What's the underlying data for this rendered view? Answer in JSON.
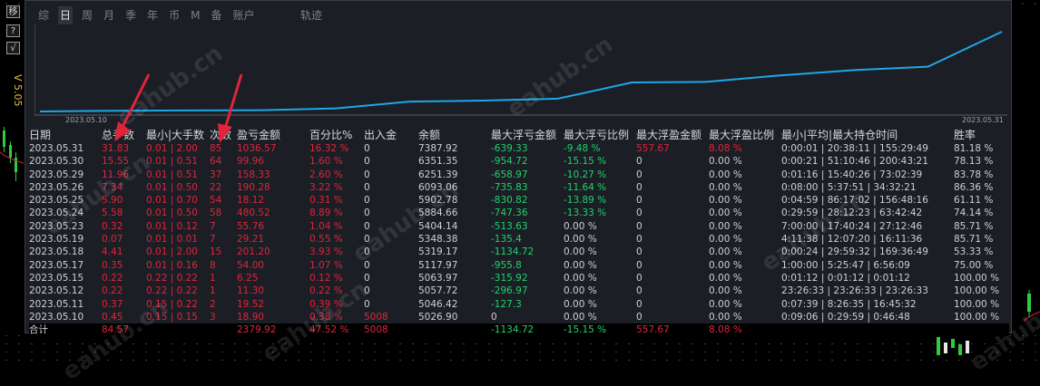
{
  "toolbar": {
    "btn_a": "移",
    "btn_b": "?",
    "btn_c": "√",
    "side_label": "V 5.05"
  },
  "tabs": [
    {
      "label": "综",
      "active": false
    },
    {
      "label": "日",
      "active": true
    },
    {
      "label": "周",
      "active": false
    },
    {
      "label": "月",
      "active": false
    },
    {
      "label": "季",
      "active": false
    },
    {
      "label": "年",
      "active": false
    },
    {
      "label": "币",
      "active": false
    },
    {
      "label": "M",
      "active": false
    },
    {
      "label": "备",
      "active": false
    },
    {
      "label": "账户",
      "active": false
    }
  ],
  "track_label": "轨迹",
  "equity_chart": {
    "start_date": "2023.05.10",
    "end_date": "2023.05.31",
    "line_color": "#1ea7e6",
    "values": [
      5026.9,
      5046.42,
      5057.72,
      5063.97,
      5117.97,
      5319.17,
      5348.38,
      5404.14,
      5884.66,
      5902.78,
      6093.06,
      6251.39,
      6351.35,
      7387.92
    ]
  },
  "table": {
    "headers": [
      "日期",
      "总手数",
      "最小|大手数",
      "次数",
      "盈亏金额",
      "百分比%",
      "出入金",
      "余额",
      "最大浮亏金额",
      "最大浮亏比例",
      "最大浮盈金额",
      "最大浮盈比例",
      "最小|平均|最大持仓时间",
      "胜率"
    ],
    "rows": [
      [
        "2023.05.31",
        "31.83",
        "0.01 | 2.00",
        "85",
        "1036.57",
        "16.32 %",
        "0",
        "7387.92",
        "-639.33",
        "-9.48 %",
        "557.67",
        "8.08 %",
        "0:00:01 | 20:38:11 | 155:29:49",
        "81.18 %"
      ],
      [
        "2023.05.30",
        "15.55",
        "0.01 | 0.51",
        "64",
        "99.96",
        "1.60 %",
        "0",
        "6351.35",
        "-954.72",
        "-15.15 %",
        "0",
        "0.00 %",
        "0:00:21 | 51:10:46 | 200:43:21",
        "78.13 %"
      ],
      [
        "2023.05.29",
        "11.96",
        "0.01 | 0.51",
        "37",
        "158.33",
        "2.60 %",
        "0",
        "6251.39",
        "-658.97",
        "-10.27 %",
        "0",
        "0.00 %",
        "0:01:16 | 15:40:26 | 73:02:39",
        "83.78 %"
      ],
      [
        "2023.05.26",
        "7.34",
        "0.01 | 0.50",
        "22",
        "190.28",
        "3.22 %",
        "0",
        "6093.06",
        "-735.83",
        "-11.64 %",
        "0",
        "0.00 %",
        "0:08:00 | 5:37:51 | 34:32:21",
        "86.36 %"
      ],
      [
        "2023.05.25",
        "5.90",
        "0.01 | 0.70",
        "54",
        "18.12",
        "0.31 %",
        "0",
        "5902.78",
        "-830.82",
        "-13.89 %",
        "0",
        "0.00 %",
        "0:04:59 | 86:17:02 | 156:48:16",
        "61.11 %"
      ],
      [
        "2023.05.24",
        "5.58",
        "0.01 | 0.50",
        "58",
        "480.52",
        "8.89 %",
        "0",
        "5884.66",
        "-747.36",
        "-13.33 %",
        "0",
        "0.00 %",
        "0:29:59 | 28:12:23 | 63:42:42",
        "74.14 %"
      ],
      [
        "2023.05.23",
        "0.32",
        "0.01 | 0.12",
        "7",
        "55.76",
        "1.04 %",
        "0",
        "5404.14",
        "-513.63",
        "0.00 %",
        "0",
        "0.00 %",
        "7:00:00 | 17:40:24 | 27:12:46",
        "85.71 %"
      ],
      [
        "2023.05.19",
        "0.07",
        "0.01 | 0.01",
        "7",
        "29.21",
        "0.55 %",
        "0",
        "5348.38",
        "-135.4",
        "0.00 %",
        "0",
        "0.00 %",
        "4:11:38 | 12:07:20 | 16:11:36",
        "85.71 %"
      ],
      [
        "2023.05.18",
        "4.41",
        "0.01 | 2.00",
        "15",
        "201.20",
        "3.93 %",
        "0",
        "5319.17",
        "-1134.72",
        "0.00 %",
        "0",
        "0.00 %",
        "0:00:24 | 29:59:32 | 169:36:49",
        "53.33 %"
      ],
      [
        "2023.05.17",
        "0.35",
        "0.01 | 0.16",
        "8",
        "54.00",
        "1.07 %",
        "0",
        "5117.97",
        "-955.8",
        "0.00 %",
        "0",
        "0.00 %",
        "1:00:00 | 5:25:47 | 6:56:09",
        "75.00 %"
      ],
      [
        "2023.05.15",
        "0.22",
        "0.22 | 0.22",
        "1",
        "6.25",
        "0.12 %",
        "0",
        "5063.97",
        "-315.92",
        "0.00 %",
        "0",
        "0.00 %",
        "0:01:12 | 0:01:12 | 0:01:12",
        "100.00 %"
      ],
      [
        "2023.05.12",
        "0.22",
        "0.22 | 0.22",
        "1",
        "11.30",
        "0.22 %",
        "0",
        "5057.72",
        "-296.97",
        "0.00 %",
        "0",
        "0.00 %",
        "23:26:33 | 23:26:33 | 23:26:33",
        "100.00 %"
      ],
      [
        "2023.05.11",
        "0.37",
        "0.15 | 0.22",
        "2",
        "19.52",
        "0.39 %",
        "0",
        "5046.42",
        "-127.3",
        "0.00 %",
        "0",
        "0.00 %",
        "0:07:39 | 8:26:35 | 16:45:32",
        "100.00 %"
      ],
      [
        "2023.05.10",
        "0.45",
        "0.15 | 0.15",
        "3",
        "18.90",
        "0.38 %",
        "5008",
        "5026.90",
        "0",
        "0.00 %",
        "0",
        "0.00 %",
        "0:09:06 | 0:29:59 | 0:46:48",
        "100.00 %"
      ]
    ],
    "total": [
      "合计",
      "84.57",
      "",
      "",
      "2379.92",
      "47.52 %",
      "5008",
      "",
      "-1134.72",
      "-15.15 %",
      "557.67",
      "8.08 %",
      "",
      ""
    ]
  },
  "watermark": "eahub.cn",
  "colors": {
    "panel_bg": "#1b1e25",
    "red": "#e0243a",
    "green": "#1fd36a",
    "arrow": "#e0243a"
  }
}
